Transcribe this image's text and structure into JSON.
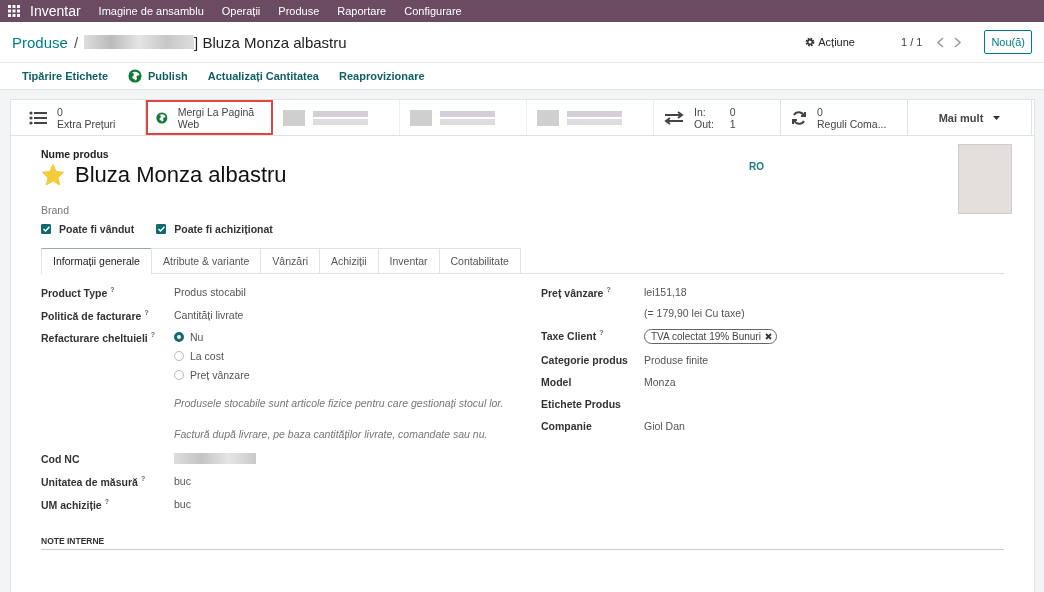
{
  "navbar": {
    "app": "Inventar",
    "menu": [
      "Imagine de ansamblu",
      "Operații",
      "Produse",
      "Raportare",
      "Configurare"
    ]
  },
  "breadcrumb": {
    "parent": "Produse",
    "separator": "/",
    "current": "] Bluza Monza albastru"
  },
  "control_panel": {
    "action": "Acțiune",
    "pager": "1 / 1",
    "new_button": "Nou(ă)"
  },
  "action_buttons": [
    {
      "kind": "plain",
      "label": "Tipărire Etichete"
    },
    {
      "kind": "globe",
      "label": "Publish"
    },
    {
      "kind": "plain",
      "label": "Actualizați Cantitatea"
    },
    {
      "kind": "plain",
      "label": "Reaprovizionare"
    }
  ],
  "smart_buttons": [
    {
      "kind": "prices",
      "value": "0",
      "label": "Extra Prețuri"
    },
    {
      "kind": "website",
      "label": "Mergi La Pagină Web",
      "highlighted": true
    },
    {
      "kind": "redacted"
    },
    {
      "kind": "redacted"
    },
    {
      "kind": "redacted"
    },
    {
      "kind": "moves",
      "in_label": "In:",
      "in_value": "0",
      "out_label": "Out:",
      "out_value": "1"
    },
    {
      "kind": "rules",
      "value": "0",
      "label": "Reguli Coma..."
    },
    {
      "kind": "more",
      "label": "Mai mult"
    }
  ],
  "product": {
    "name_label": "Nume produs",
    "name": "Bluza Monza albastru",
    "favorite": true,
    "language": "RO",
    "brand_label": "Brand",
    "checkboxes": [
      {
        "label": "Poate fi vândut",
        "checked": true
      },
      {
        "label": "Poate fi achiziționat",
        "checked": true
      }
    ]
  },
  "tabs": [
    {
      "label": "Informații generale",
      "selected": true
    },
    {
      "label": "Atribute & variante",
      "selected": false
    },
    {
      "label": "Vânzări",
      "selected": false
    },
    {
      "label": "Achiziții",
      "selected": false
    },
    {
      "label": "Inventar",
      "selected": false
    },
    {
      "label": "Contabilitate",
      "selected": false
    }
  ],
  "left_fields": [
    {
      "kind": "text",
      "label": "Product Type",
      "help": "?",
      "value": "Produs stocabil"
    },
    {
      "kind": "text",
      "label": "Politică de facturare",
      "help": "?",
      "value": "Cantități livrate"
    },
    {
      "kind": "radio",
      "label": "Refacturare cheltuieli",
      "help": "?",
      "options": [
        {
          "label": "Nu",
          "selected": true
        },
        {
          "label": "La cost",
          "selected": false
        },
        {
          "label": "Preț vânzare",
          "selected": false
        }
      ]
    },
    {
      "kind": "note",
      "value": "Produsele stocabile sunt articole fizice pentru care gestionați stocul lor."
    },
    {
      "kind": "note",
      "value": "Factură după livrare, pe baza cantităților livrate, comandate sau nu."
    },
    {
      "kind": "redacted",
      "label": "Cod NC"
    },
    {
      "kind": "text",
      "label": "Unitatea de măsură",
      "help": "?",
      "value": "buc"
    },
    {
      "kind": "text",
      "label": "UM achiziție",
      "help": "?",
      "value": "buc"
    }
  ],
  "right_fields": [
    {
      "kind": "text",
      "label": "Preț vânzare",
      "help": "?",
      "value": "lei151,18"
    },
    {
      "kind": "subnote",
      "value": "(= 179,90 lei Cu taxe)"
    },
    {
      "kind": "tag",
      "label": "Taxe Client",
      "help": "?",
      "value": "TVA colectat 19% Bunuri"
    },
    {
      "kind": "text",
      "label": "Categorie produs",
      "value": "Produse finite"
    },
    {
      "kind": "text",
      "label": "Model",
      "value": "Monza"
    },
    {
      "kind": "text",
      "label": "Etichete Produs"
    },
    {
      "kind": "text",
      "label": "Companie",
      "value": "Giol Dan"
    }
  ],
  "section_title": "NOTE INTERNE"
}
